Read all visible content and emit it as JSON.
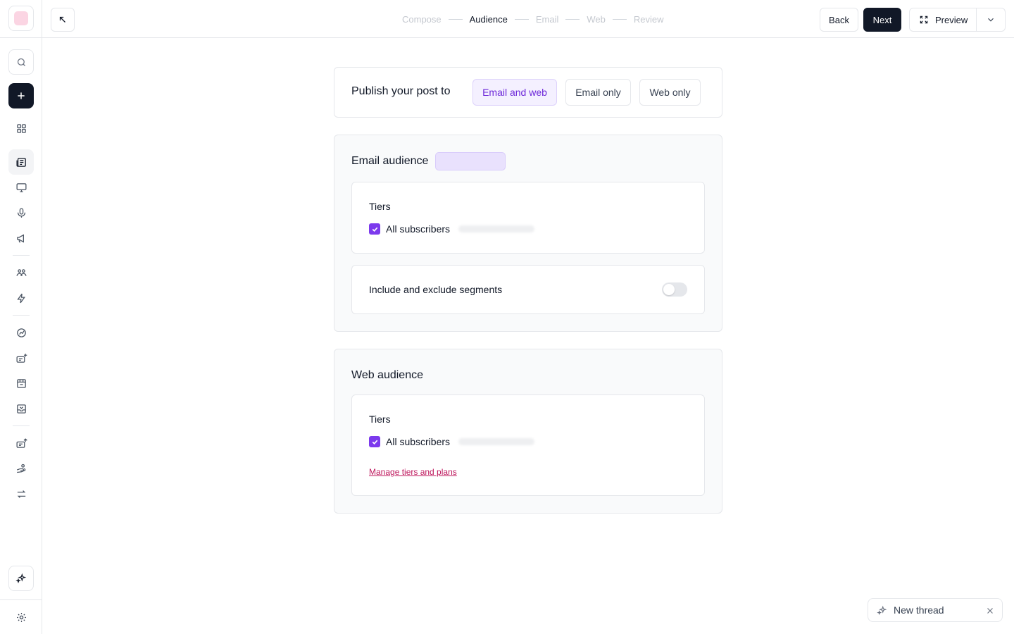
{
  "sidebar": {
    "icons": [
      "logo",
      "search-icon",
      "plus-icon",
      "grid-icon",
      "posts-icon",
      "monitor-icon",
      "microphone-icon",
      "megaphone-icon",
      "users-icon",
      "lightning-icon",
      "analytics-icon",
      "subscribe-icon",
      "store-icon",
      "inbox-icon",
      "export-icon",
      "handshake-icon",
      "repeat-icon",
      "sparkles-icon",
      "gear-icon"
    ]
  },
  "header": {
    "steps": [
      "Compose",
      "Audience",
      "Email",
      "Web",
      "Review"
    ],
    "current_step": "Audience",
    "back_label": "Back",
    "next_label": "Next",
    "preview_label": "Preview"
  },
  "publish": {
    "label": "Publish your post to",
    "options": [
      "Email and web",
      "Email only",
      "Web only"
    ],
    "selected": "Email and web"
  },
  "email_audience": {
    "title": "Email audience",
    "tiers_label": "Tiers",
    "all_subscribers_label": "All subscribers",
    "all_subscribers_checked": true,
    "segments_label": "Include and exclude segments",
    "segments_enabled": false
  },
  "web_audience": {
    "title": "Web audience",
    "tiers_label": "Tiers",
    "all_subscribers_label": "All subscribers",
    "all_subscribers_checked": true,
    "manage_link": "Manage tiers and plans"
  },
  "thread": {
    "label": "New thread"
  },
  "colors": {
    "accent": "#7c3aed",
    "primary_button": "#111827",
    "link": "#be185d",
    "selected_option_bg": "#f4f0ff"
  }
}
